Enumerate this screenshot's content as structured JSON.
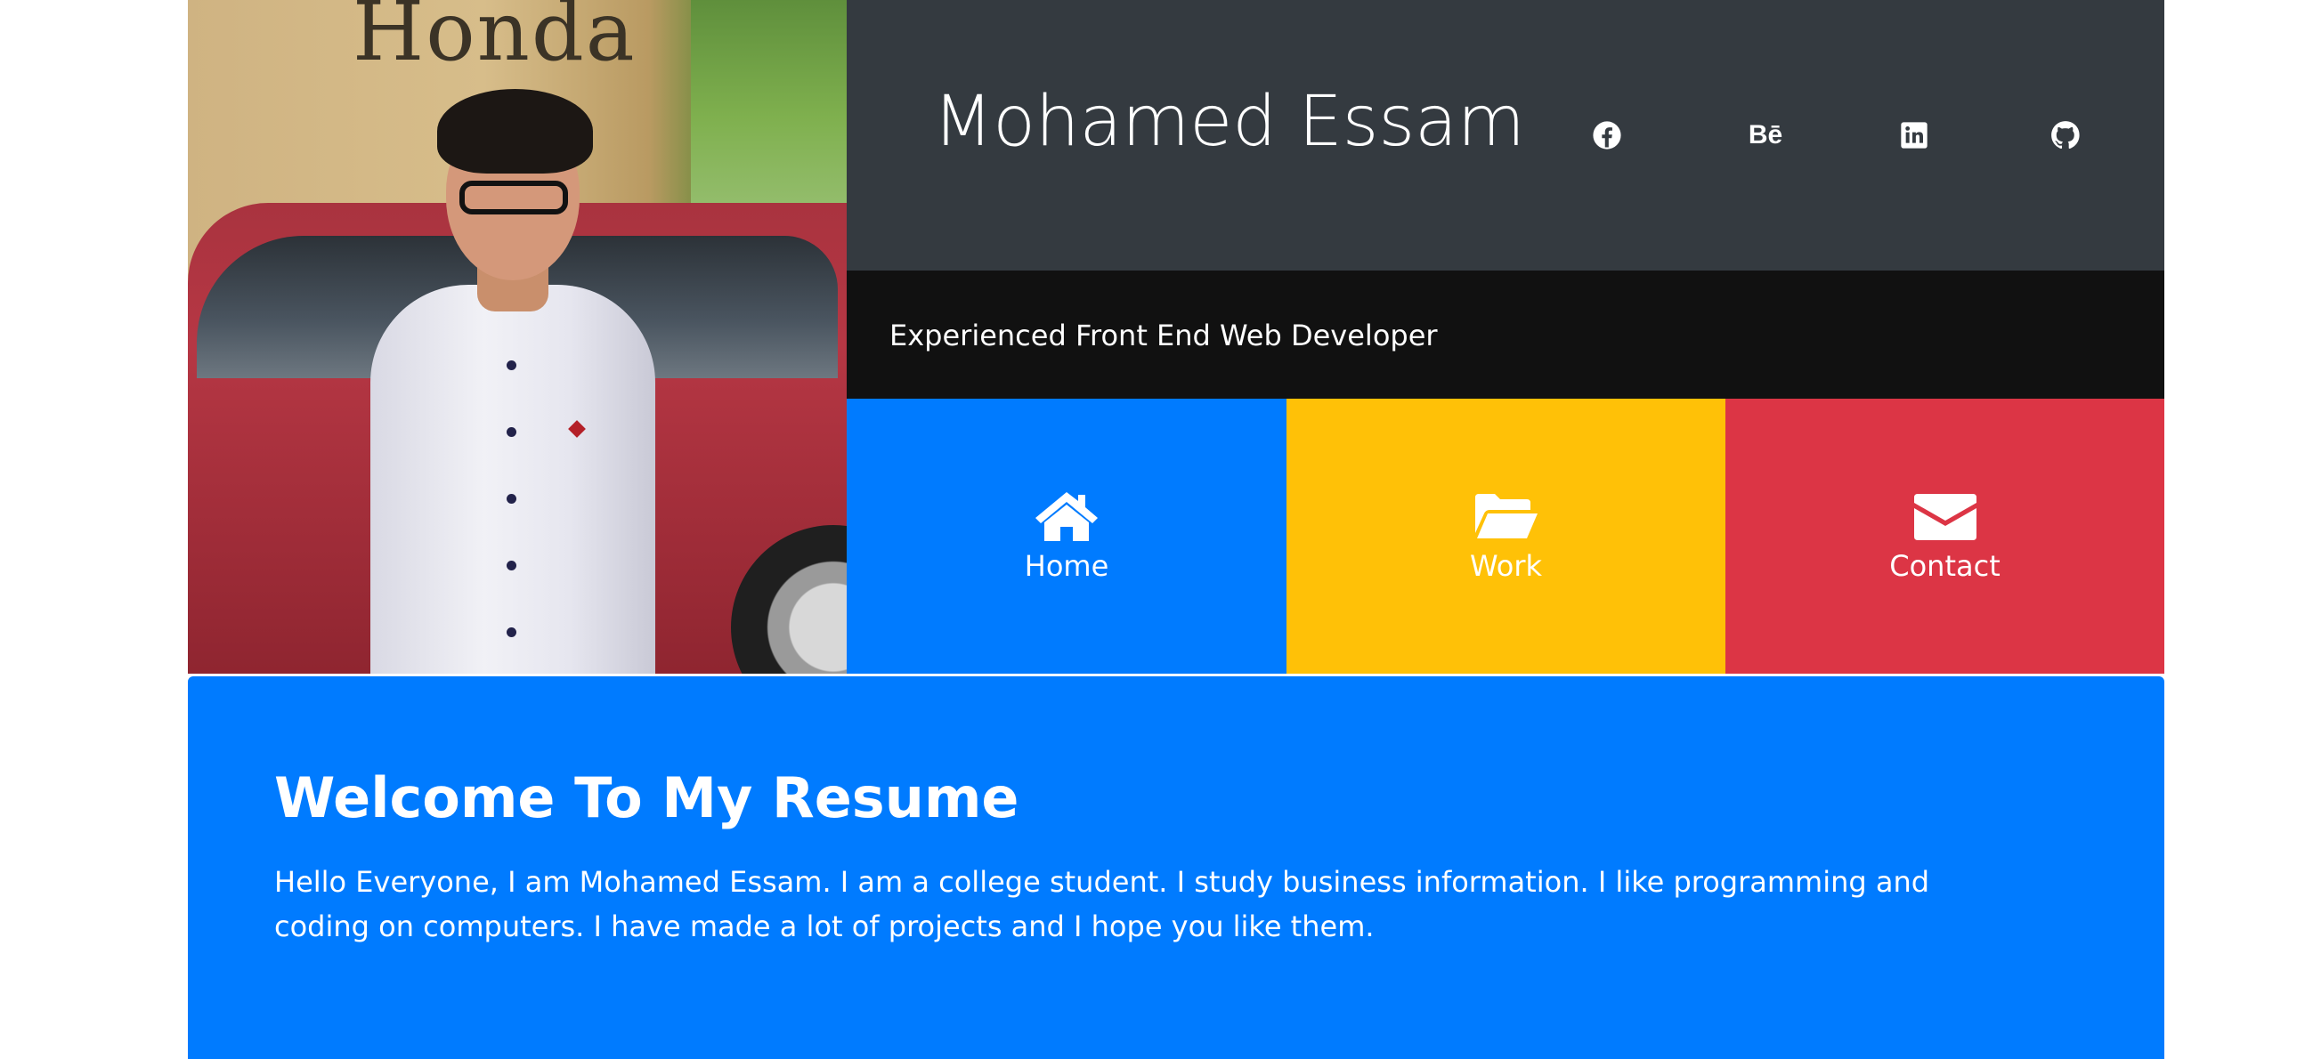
{
  "header": {
    "name": "Mohamed Essam",
    "tagline": "Experienced Front End Web Developer",
    "background_color": "#343a40",
    "tagline_background_color": "#111111"
  },
  "social_links": [
    {
      "icon": "facebook-icon"
    },
    {
      "icon": "behance-icon",
      "glyph": "Bē"
    },
    {
      "icon": "linkedin-icon"
    },
    {
      "icon": "github-icon"
    }
  ],
  "photo": {
    "graffiti_text": "Honda"
  },
  "nav": {
    "home": {
      "label": "Home",
      "icon": "home-icon",
      "color": "#007bff"
    },
    "work": {
      "label": "Work",
      "icon": "folder-open-icon",
      "color": "#ffc107"
    },
    "contact": {
      "label": "Contact",
      "icon": "envelope-icon",
      "color": "#dc3545"
    }
  },
  "welcome": {
    "title": "Welcome To My Resume",
    "text": "Hello Everyone, I am Mohamed Essam. I am a college student. I study business information. I like programming and coding on computers. I have made a lot of projects and I hope you like them.",
    "background_color": "#007bff"
  }
}
